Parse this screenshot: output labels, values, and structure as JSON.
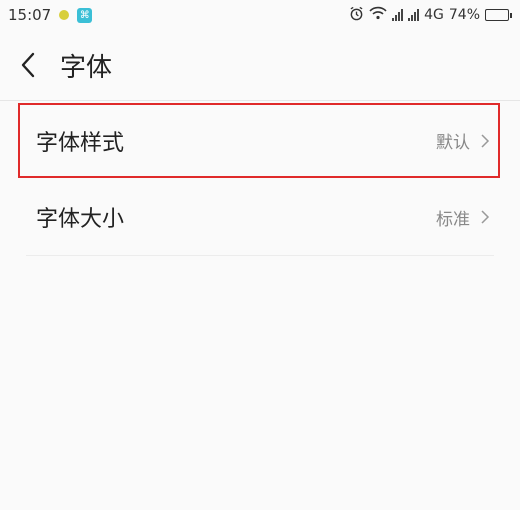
{
  "status_bar": {
    "time": "15:07",
    "network": "4G",
    "battery": "74%",
    "battery_level": 0.74,
    "battery_color": "#35c23a"
  },
  "header": {
    "title": "字体"
  },
  "settings": [
    {
      "label": "字体样式",
      "value": "默认"
    },
    {
      "label": "字体大小",
      "value": "标准"
    }
  ],
  "colors": {
    "highlight": "#e02a2a"
  }
}
